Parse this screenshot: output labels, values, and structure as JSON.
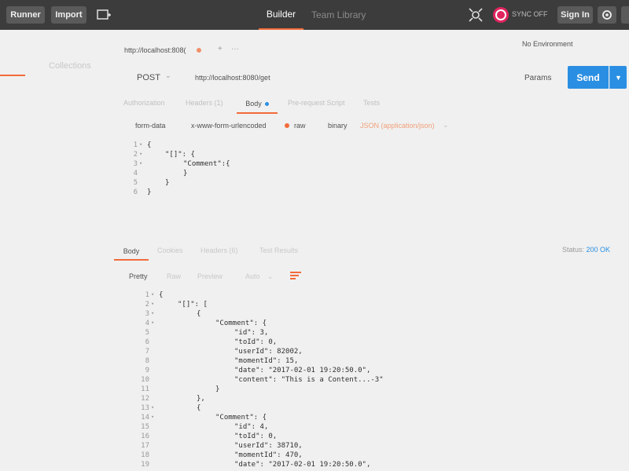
{
  "topbar": {
    "runner": "Runner",
    "import": "Import",
    "builder": "Builder",
    "team_library": "Team Library",
    "sync": "SYNC OFF",
    "sign_in": "Sign In"
  },
  "sidebar": {
    "collections": "Collections"
  },
  "request": {
    "tab_label": "http://localhost:808(",
    "tab_more": "···",
    "environment": "No Environment",
    "method": "POST",
    "url": "http://localhost:8080/get",
    "params": "Params",
    "send": "Send",
    "tabs": [
      "Authorization",
      "Headers (1)",
      "Body",
      "Pre-request Script",
      "Tests"
    ],
    "body_types": [
      "form-data",
      "x-www-form-urlencoded",
      "raw",
      "binary"
    ],
    "content_type": "JSON (application/json)"
  },
  "request_body": {
    "lines": [
      {
        "n": "1",
        "fold": true,
        "indent": 0,
        "text": "{"
      },
      {
        "n": "2",
        "fold": true,
        "indent": 1,
        "text": "\"[]\": {"
      },
      {
        "n": "3",
        "fold": true,
        "indent": 2,
        "text": "\"Comment\":{"
      },
      {
        "n": "4",
        "fold": false,
        "indent": 2,
        "text": "}"
      },
      {
        "n": "5",
        "fold": false,
        "indent": 1,
        "text": "}"
      },
      {
        "n": "6",
        "fold": false,
        "indent": 0,
        "text": "}"
      }
    ]
  },
  "response": {
    "tabs": [
      "Body",
      "Cookies",
      "Headers (6)",
      "Test Results"
    ],
    "status_label": "Status:",
    "status_value": "200 OK",
    "formats": [
      "Pretty",
      "Raw",
      "Preview",
      "Auto"
    ],
    "lines": [
      {
        "n": "1",
        "fold": true,
        "indent": 0,
        "text": "{"
      },
      {
        "n": "2",
        "fold": true,
        "indent": 1,
        "text": "\"[]\": ["
      },
      {
        "n": "3",
        "fold": true,
        "indent": 2,
        "text": "{"
      },
      {
        "n": "4",
        "fold": true,
        "indent": 3,
        "text": "\"Comment\": {"
      },
      {
        "n": "5",
        "fold": false,
        "indent": 4,
        "text": "\"id\": 3,"
      },
      {
        "n": "6",
        "fold": false,
        "indent": 4,
        "text": "\"toId\": 0,"
      },
      {
        "n": "7",
        "fold": false,
        "indent": 4,
        "text": "\"userId\": 82002,"
      },
      {
        "n": "8",
        "fold": false,
        "indent": 4,
        "text": "\"momentId\": 15,"
      },
      {
        "n": "9",
        "fold": false,
        "indent": 4,
        "text": "\"date\": \"2017-02-01 19:20:50.0\","
      },
      {
        "n": "10",
        "fold": false,
        "indent": 4,
        "text": "\"content\": \"This is a Content...-3\""
      },
      {
        "n": "11",
        "fold": false,
        "indent": 3,
        "text": "}"
      },
      {
        "n": "12",
        "fold": false,
        "indent": 2,
        "text": "},"
      },
      {
        "n": "13",
        "fold": true,
        "indent": 2,
        "text": "{"
      },
      {
        "n": "14",
        "fold": true,
        "indent": 3,
        "text": "\"Comment\": {"
      },
      {
        "n": "15",
        "fold": false,
        "indent": 4,
        "text": "\"id\": 4,"
      },
      {
        "n": "16",
        "fold": false,
        "indent": 4,
        "text": "\"toId\": 0,"
      },
      {
        "n": "17",
        "fold": false,
        "indent": 4,
        "text": "\"userId\": 38710,"
      },
      {
        "n": "18",
        "fold": false,
        "indent": 4,
        "text": "\"momentId\": 470,"
      },
      {
        "n": "19",
        "fold": false,
        "indent": 4,
        "text": "\"date\": \"2017-02-01 19:20:50.0\","
      }
    ]
  },
  "colors": {
    "accent": "#f26b3a",
    "send": "#2a8fe2",
    "topbar": "#3c3c3c",
    "sync": "#e0245e"
  },
  "icons": [
    "new-tab-icon",
    "interceptor-icon",
    "sync-icon",
    "satellite-icon",
    "chevron-down-icon",
    "text-wrap-icon",
    "fold-arrow-icon"
  ]
}
